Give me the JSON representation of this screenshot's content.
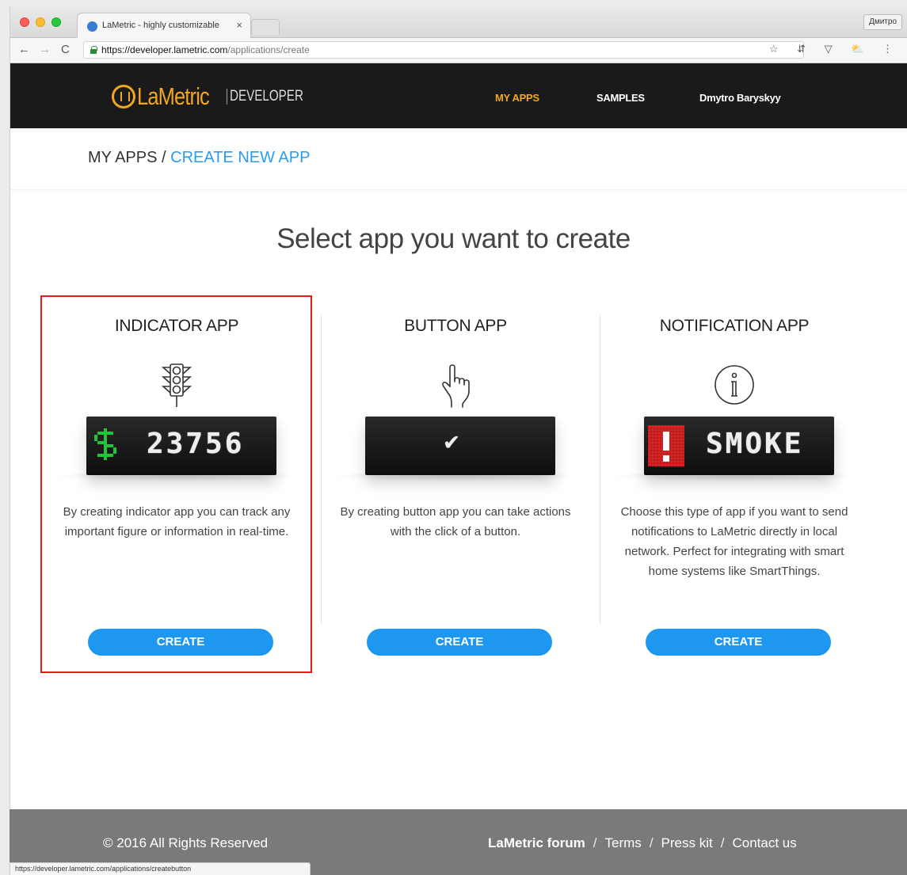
{
  "browser": {
    "tab_title": "LaMetric - highly customizable",
    "tab_close": "×",
    "profile_name": "Дмитро",
    "url_scheme_host": "https://developer.lametric.com",
    "url_path": "/applications/create",
    "nav_back": "←",
    "nav_forward": "→",
    "nav_reload": "C",
    "extensions": "☆ ⇵ ▽ ⛅ ⋮",
    "status_url": "https://developer.lametric.com/applications/createbutton"
  },
  "header": {
    "logo_main": "LaMetric",
    "logo_sub": "DEVELOPER",
    "brand_color": "#f2a71f",
    "nav": {
      "my_apps": "MY APPS",
      "samples": "SAMPLES",
      "user": "Dmytro Baryskyy"
    }
  },
  "breadcrumb": {
    "parent": "MY APPS",
    "separator": " / ",
    "current": "CREATE NEW APP",
    "current_color": "#2a9cf0"
  },
  "main": {
    "heading": "Select app you want to create",
    "cards": [
      {
        "title": "INDICATOR APP",
        "icon": "traffic-light-icon",
        "display_text": "23756",
        "description": "By creating indicator app you can track any important figure or information in real-time.",
        "button": "CREATE",
        "highlighted": true
      },
      {
        "title": "BUTTON APP",
        "icon": "pointing-hand-icon",
        "display_text": "✔",
        "description": "By creating button app you can take actions with the click of a button.",
        "button": "CREATE",
        "highlighted": false
      },
      {
        "title": "NOTIFICATION APP",
        "icon": "info-icon",
        "display_text": "SMOKE",
        "description": "Choose this type of app if you want to send notifications to LaMetric directly in local network. Perfect for integrating with smart home systems like SmartThings.",
        "button": "CREATE",
        "highlighted": false
      }
    ],
    "button_color": "#1e97f0",
    "highlight_color": "#e61c1c"
  },
  "footer": {
    "copyright": "© 2016 All Rights Reserved",
    "links": {
      "forum": "LaMetric forum",
      "terms": "Terms",
      "press": "Press kit",
      "contact": "Contact us"
    },
    "separator": "/"
  }
}
